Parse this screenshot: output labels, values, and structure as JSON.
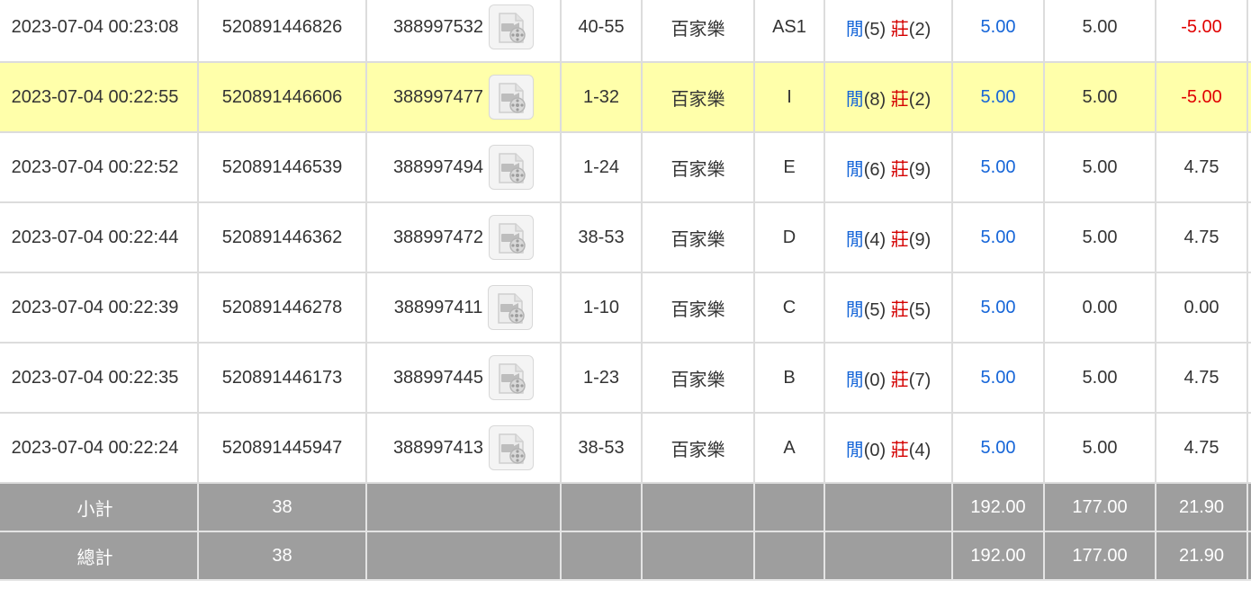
{
  "rows": [
    {
      "time": "2023-07-04 00:23:08",
      "bet_no": "520891446826",
      "round_no": "388997532",
      "table": "40-55",
      "game": "百家樂",
      "shoe": "AS1",
      "result_a_label": "閒",
      "result_a_val": "(5)",
      "result_b_label": "莊",
      "result_b_val": "(2)",
      "bet": "5.00",
      "valid": "5.00",
      "win": "-5.00"
    },
    {
      "time": "2023-07-04 00:22:55",
      "bet_no": "520891446606",
      "round_no": "388997477",
      "table": "1-32",
      "game": "百家樂",
      "shoe": "I",
      "result_a_label": "閒",
      "result_a_val": "(8)",
      "result_b_label": "莊",
      "result_b_val": "(2)",
      "bet": "5.00",
      "valid": "5.00",
      "win": "-5.00"
    },
    {
      "time": "2023-07-04 00:22:52",
      "bet_no": "520891446539",
      "round_no": "388997494",
      "table": "1-24",
      "game": "百家樂",
      "shoe": "E",
      "result_a_label": "閒",
      "result_a_val": "(6)",
      "result_b_label": "莊",
      "result_b_val": "(9)",
      "bet": "5.00",
      "valid": "5.00",
      "win": "4.75"
    },
    {
      "time": "2023-07-04 00:22:44",
      "bet_no": "520891446362",
      "round_no": "388997472",
      "table": "38-53",
      "game": "百家樂",
      "shoe": "D",
      "result_a_label": "閒",
      "result_a_val": "(4)",
      "result_b_label": "莊",
      "result_b_val": "(9)",
      "bet": "5.00",
      "valid": "5.00",
      "win": "4.75"
    },
    {
      "time": "2023-07-04 00:22:39",
      "bet_no": "520891446278",
      "round_no": "388997411",
      "table": "1-10",
      "game": "百家樂",
      "shoe": "C",
      "result_a_label": "閒",
      "result_a_val": "(5)",
      "result_b_label": "莊",
      "result_b_val": "(5)",
      "bet": "5.00",
      "valid": "0.00",
      "win": "0.00"
    },
    {
      "time": "2023-07-04 00:22:35",
      "bet_no": "520891446173",
      "round_no": "388997445",
      "table": "1-23",
      "game": "百家樂",
      "shoe": "B",
      "result_a_label": "閒",
      "result_a_val": "(0)",
      "result_b_label": "莊",
      "result_b_val": "(7)",
      "bet": "5.00",
      "valid": "5.00",
      "win": "4.75"
    },
    {
      "time": "2023-07-04 00:22:24",
      "bet_no": "520891445947",
      "round_no": "388997413",
      "table": "38-53",
      "game": "百家樂",
      "shoe": "A",
      "result_a_label": "閒",
      "result_a_val": "(0)",
      "result_b_label": "莊",
      "result_b_val": "(4)",
      "bet": "5.00",
      "valid": "5.00",
      "win": "4.75"
    }
  ],
  "subtotal": {
    "label": "小計",
    "count": "38",
    "bet": "192.00",
    "valid": "177.00",
    "win": "21.90"
  },
  "total": {
    "label": "總計",
    "count": "38",
    "bet": "192.00",
    "valid": "177.00",
    "win": "21.90"
  },
  "colors": {
    "highlight_row": "#ffffaa",
    "summary_bg": "#9e9e9e",
    "bet_blue": "#1565d8",
    "banker_red": "#d40000",
    "loss_red": "#e10000"
  },
  "icons": {
    "replay": "video-replay-icon"
  }
}
